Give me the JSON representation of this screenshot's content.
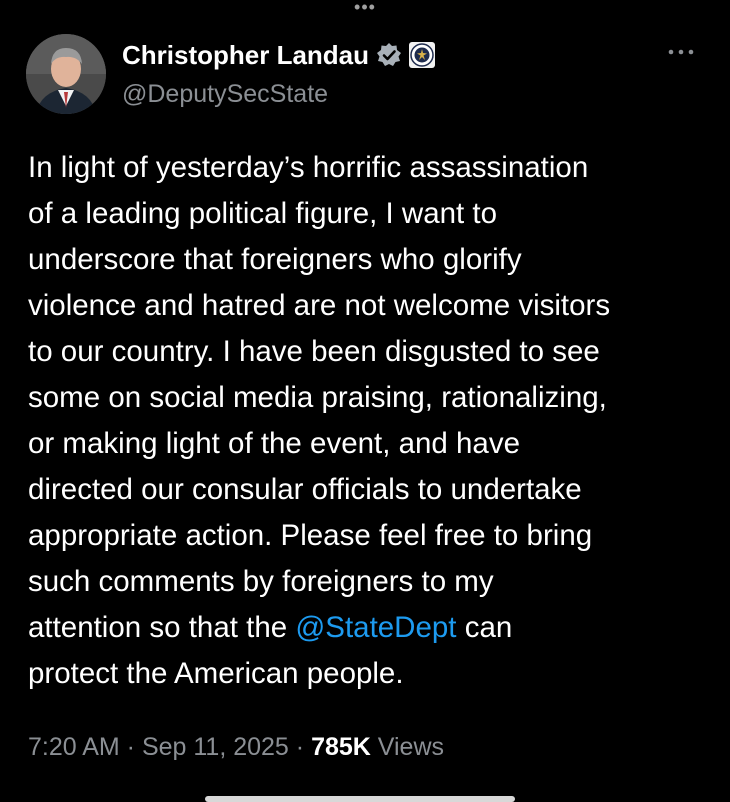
{
  "top_menu": {
    "label": "•••"
  },
  "author": {
    "name": "Christopher Landau",
    "handle": "@DeputySecState",
    "verified_icon": "verified-badge-icon",
    "affiliation_icon": "state-department-seal-icon"
  },
  "more_menu": {
    "label": "•••"
  },
  "tweet": {
    "lines": [
      [
        "In light of yesterday’s horrific assassination"
      ],
      [
        "of a leading political figure, I want to"
      ],
      [
        "underscore that foreigners who glorify"
      ],
      [
        "violence and hatred are not welcome visitors"
      ],
      [
        "to our country. I have been disgusted to see"
      ],
      [
        "some on social media praising, rationalizing,"
      ],
      [
        "or making light of the event, and have"
      ],
      [
        "directed our consular officials to undertake"
      ],
      [
        "appropriate action. Please feel free to bring"
      ],
      [
        "such comments by foreigners to my"
      ],
      [
        "attention so that the ",
        "@StateDept",
        " can"
      ],
      [
        "protect the American people."
      ]
    ],
    "mention": "@StateDept"
  },
  "meta": {
    "time": "7:20 AM",
    "separator": " · ",
    "date": "Sep 11, 2025",
    "views_count": "785K",
    "views_label": "Views"
  },
  "colors": {
    "background": "#000000",
    "text": "#ffffff",
    "muted": "#8b8f94",
    "link": "#1d9bf0",
    "verified": "#a8b0b8"
  }
}
